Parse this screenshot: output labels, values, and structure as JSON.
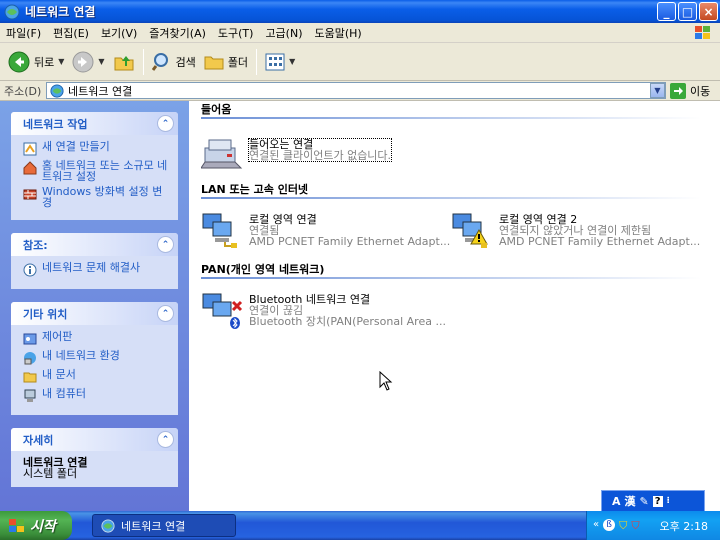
{
  "window": {
    "title": "네트워크 연결",
    "minimize": "_",
    "maximize": "□",
    "close": "×"
  },
  "menu": [
    "파일(F)",
    "편집(E)",
    "보기(V)",
    "즐겨찾기(A)",
    "도구(T)",
    "고급(N)",
    "도움말(H)"
  ],
  "toolbar": {
    "back": "뒤로",
    "search": "검색",
    "folders": "폴더"
  },
  "address": {
    "label": "주소(D)",
    "value": "네트워크 연결",
    "go": "이동"
  },
  "sidebar": {
    "network_tasks": {
      "title": "네트워크 작업",
      "items": [
        "새 연결 만들기",
        "홈 네트워크 또는 소규모 네트워크 설정",
        "Windows 방화벽 설정 변경"
      ]
    },
    "see_also": {
      "title": "참조:",
      "items": [
        "네트워크 문제 해결사"
      ]
    },
    "other_places": {
      "title": "기타 위치",
      "items": [
        "제어판",
        "내 네트워크 환경",
        "내 문서",
        "내 컴퓨터"
      ]
    },
    "details": {
      "title": "자세히",
      "name": "네트워크 연결",
      "sub": "시스템 폴더"
    }
  },
  "groups": {
    "incoming": {
      "title": "들어옴",
      "items": [
        {
          "name": "들어오는 연결",
          "status": "연결된 클라이언트가 없습니다."
        }
      ]
    },
    "lan": {
      "title": "LAN 또는 고속 인터넷",
      "items": [
        {
          "name": "로컬 영역 연결",
          "status": "연결됨",
          "device": "AMD PCNET Family Ethernet Adapt..."
        },
        {
          "name": "로컬 영역 연결 2",
          "status": "연결되지 않았거나 연결이 제한됨",
          "device": "AMD PCNET Family Ethernet Adapt..."
        }
      ]
    },
    "pan": {
      "title": "PAN(개인 영역 네트워크)",
      "items": [
        {
          "name": "Bluetooth 네트워크 연결",
          "status": "연결이 끊김",
          "device": "Bluetooth 장치(PAN(Personal Area ..."
        }
      ]
    }
  },
  "langbar": {
    "mode": "A",
    "hanja": "漢"
  },
  "taskbar": {
    "start": "시작",
    "task": "네트워크 연결",
    "clock": "오후 2:18"
  }
}
